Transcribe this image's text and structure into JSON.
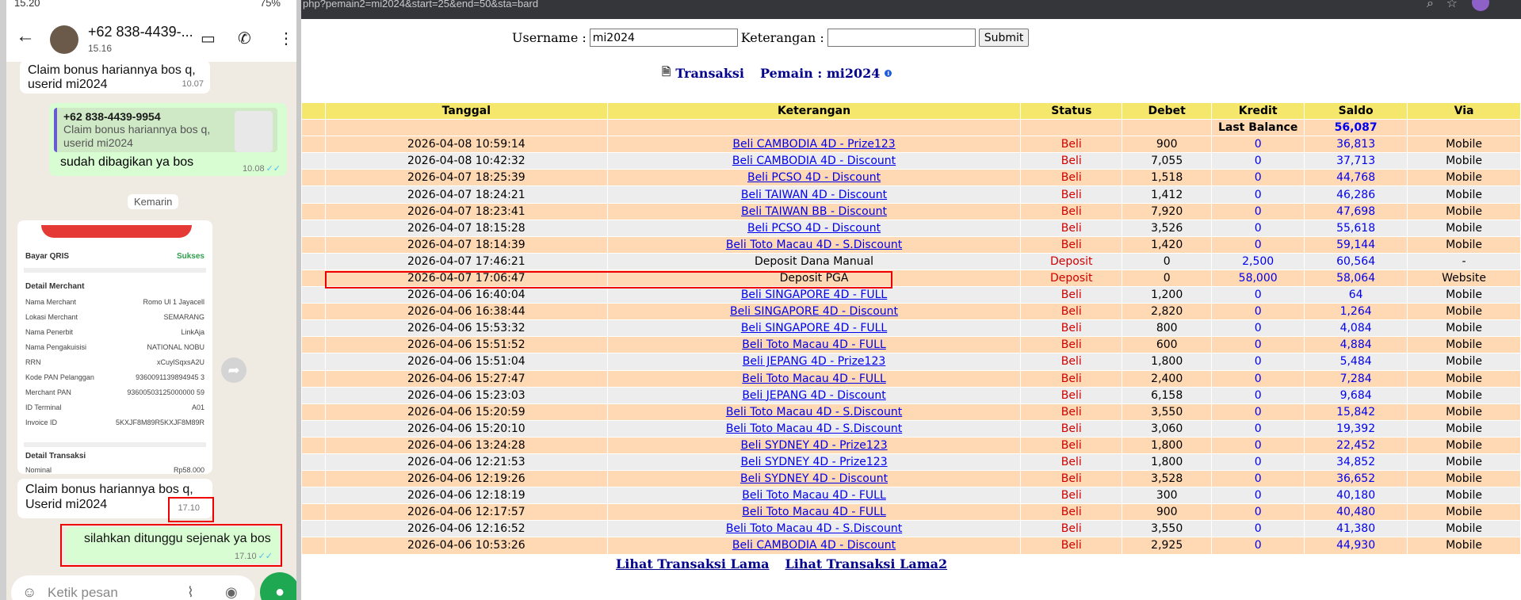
{
  "browser": {
    "url": "php?pemain2=mi2024&start=25&end=50&sta=bard",
    "search_icon": "search-icon",
    "star_icon": "star-icon"
  },
  "form": {
    "username_label": "Username :",
    "username_value": "mi2024",
    "keterangan_label": "Keterangan :",
    "keterangan_value": "",
    "submit_label": "Submit"
  },
  "heading": {
    "transaksi": "Transaksi",
    "pemain": "Pemain : mi2024"
  },
  "table": {
    "headers": [
      "Tanggal",
      "Keterangan",
      "Status",
      "Debet",
      "Kredit",
      "Saldo",
      "Via"
    ],
    "last_balance_label": "Last Balance",
    "last_balance_value": "56,087",
    "rows": [
      {
        "tanggal": "2026-04-08 10:59:14",
        "keterangan": "Beli CAMBODIA 4D - Prize123",
        "link": true,
        "status": "Beli",
        "debet": "900",
        "kredit": "0",
        "saldo": "36,813",
        "via": "Mobile"
      },
      {
        "tanggal": "2026-04-08 10:42:32",
        "keterangan": "Beli CAMBODIA 4D - Discount",
        "link": true,
        "status": "Beli",
        "debet": "7,055",
        "kredit": "0",
        "saldo": "37,713",
        "via": "Mobile"
      },
      {
        "tanggal": "2026-04-07 18:25:39",
        "keterangan": "Beli PCSO 4D - Discount",
        "link": true,
        "status": "Beli",
        "debet": "1,518",
        "kredit": "0",
        "saldo": "44,768",
        "via": "Mobile"
      },
      {
        "tanggal": "2026-04-07 18:24:21",
        "keterangan": "Beli TAIWAN 4D - Discount",
        "link": true,
        "status": "Beli",
        "debet": "1,412",
        "kredit": "0",
        "saldo": "46,286",
        "via": "Mobile"
      },
      {
        "tanggal": "2026-04-07 18:23:41",
        "keterangan": "Beli TAIWAN BB - Discount",
        "link": true,
        "status": "Beli",
        "debet": "7,920",
        "kredit": "0",
        "saldo": "47,698",
        "via": "Mobile"
      },
      {
        "tanggal": "2026-04-07 18:15:28",
        "keterangan": "Beli PCSO 4D - Discount",
        "link": true,
        "status": "Beli",
        "debet": "3,526",
        "kredit": "0",
        "saldo": "55,618",
        "via": "Mobile"
      },
      {
        "tanggal": "2026-04-07 18:14:39",
        "keterangan": "Beli Toto Macau 4D - S.Discount",
        "link": true,
        "status": "Beli",
        "debet": "1,420",
        "kredit": "0",
        "saldo": "59,144",
        "via": "Mobile"
      },
      {
        "tanggal": "2026-04-07 17:46:21",
        "keterangan": "Deposit Dana Manual",
        "link": false,
        "status": "Deposit",
        "debet": "0",
        "kredit": "2,500",
        "saldo": "60,564",
        "via": "-"
      },
      {
        "tanggal": "2026-04-07 17:06:47",
        "keterangan": "Deposit PGA",
        "link": false,
        "status": "Deposit",
        "debet": "0",
        "kredit": "58,000",
        "saldo": "58,064",
        "via": "Website"
      },
      {
        "tanggal": "2026-04-06 16:40:04",
        "keterangan": "Beli SINGAPORE 4D - FULL",
        "link": true,
        "status": "Beli",
        "debet": "1,200",
        "kredit": "0",
        "saldo": "64",
        "via": "Mobile"
      },
      {
        "tanggal": "2026-04-06 16:38:44",
        "keterangan": "Beli SINGAPORE 4D - Discount",
        "link": true,
        "status": "Beli",
        "debet": "2,820",
        "kredit": "0",
        "saldo": "1,264",
        "via": "Mobile"
      },
      {
        "tanggal": "2026-04-06 15:53:32",
        "keterangan": "Beli SINGAPORE 4D - FULL",
        "link": true,
        "status": "Beli",
        "debet": "800",
        "kredit": "0",
        "saldo": "4,084",
        "via": "Mobile"
      },
      {
        "tanggal": "2026-04-06 15:51:52",
        "keterangan": "Beli Toto Macau 4D - FULL",
        "link": true,
        "status": "Beli",
        "debet": "600",
        "kredit": "0",
        "saldo": "4,884",
        "via": "Mobile"
      },
      {
        "tanggal": "2026-04-06 15:51:04",
        "keterangan": "Beli JEPANG 4D - Prize123",
        "link": true,
        "status": "Beli",
        "debet": "1,800",
        "kredit": "0",
        "saldo": "5,484",
        "via": "Mobile"
      },
      {
        "tanggal": "2026-04-06 15:27:47",
        "keterangan": "Beli Toto Macau 4D - FULL",
        "link": true,
        "status": "Beli",
        "debet": "2,400",
        "kredit": "0",
        "saldo": "7,284",
        "via": "Mobile"
      },
      {
        "tanggal": "2026-04-06 15:23:03",
        "keterangan": "Beli JEPANG 4D - Discount",
        "link": true,
        "status": "Beli",
        "debet": "6,158",
        "kredit": "0",
        "saldo": "9,684",
        "via": "Mobile"
      },
      {
        "tanggal": "2026-04-06 15:20:59",
        "keterangan": "Beli Toto Macau 4D - S.Discount",
        "link": true,
        "status": "Beli",
        "debet": "3,550",
        "kredit": "0",
        "saldo": "15,842",
        "via": "Mobile"
      },
      {
        "tanggal": "2026-04-06 15:20:10",
        "keterangan": "Beli Toto Macau 4D - S.Discount",
        "link": true,
        "status": "Beli",
        "debet": "3,060",
        "kredit": "0",
        "saldo": "19,392",
        "via": "Mobile"
      },
      {
        "tanggal": "2026-04-06 13:24:28",
        "keterangan": "Beli SYDNEY 4D - Prize123",
        "link": true,
        "status": "Beli",
        "debet": "1,800",
        "kredit": "0",
        "saldo": "22,452",
        "via": "Mobile"
      },
      {
        "tanggal": "2026-04-06 12:21:53",
        "keterangan": "Beli SYDNEY 4D - Prize123",
        "link": true,
        "status": "Beli",
        "debet": "1,800",
        "kredit": "0",
        "saldo": "34,852",
        "via": "Mobile"
      },
      {
        "tanggal": "2026-04-06 12:19:26",
        "keterangan": "Beli SYDNEY 4D - Discount",
        "link": true,
        "status": "Beli",
        "debet": "3,528",
        "kredit": "0",
        "saldo": "36,652",
        "via": "Mobile"
      },
      {
        "tanggal": "2026-04-06 12:18:19",
        "keterangan": "Beli Toto Macau 4D - FULL",
        "link": true,
        "status": "Beli",
        "debet": "300",
        "kredit": "0",
        "saldo": "40,180",
        "via": "Mobile"
      },
      {
        "tanggal": "2026-04-06 12:17:57",
        "keterangan": "Beli Toto Macau 4D - FULL",
        "link": true,
        "status": "Beli",
        "debet": "900",
        "kredit": "0",
        "saldo": "40,480",
        "via": "Mobile"
      },
      {
        "tanggal": "2026-04-06 12:16:52",
        "keterangan": "Beli Toto Macau 4D - S.Discount",
        "link": true,
        "status": "Beli",
        "debet": "3,550",
        "kredit": "0",
        "saldo": "41,380",
        "via": "Mobile"
      },
      {
        "tanggal": "2026-04-06 10:53:26",
        "keterangan": "Beli CAMBODIA 4D - Discount",
        "link": true,
        "status": "Beli",
        "debet": "2,925",
        "kredit": "0",
        "saldo": "44,930",
        "via": "Mobile"
      }
    ]
  },
  "footer": {
    "link1": "Lihat Transaksi Lama",
    "link2": "Lihat Transaksi Lama2"
  },
  "phone": {
    "status_time": "15.20",
    "status_battery": "75%",
    "contact_name": "+62 838-4439-...",
    "contact_sub": "15.16",
    "msg1_text": "Claim bonus hariannya bos q, userid mi2024",
    "msg1_time": "10.07",
    "quote_name": "+62 838-4439-9954",
    "quote_text": "Claim bonus hariannya bos q, userid mi2024",
    "reply_text": "sudah dibagikan ya bos",
    "reply_time": "10.08",
    "date_chip": "Kemarin",
    "receipt": {
      "title": "Bayar QRIS",
      "status": "Sukses",
      "section1": "Detail Merchant",
      "rows": [
        {
          "k": "Nama Merchant",
          "v": "Romo Ul 1 Jayacell"
        },
        {
          "k": "Lokasi Merchant",
          "v": "SEMARANG"
        },
        {
          "k": "Nama Penerbit",
          "v": "LinkAja"
        },
        {
          "k": "Nama Pengakuisisi",
          "v": "NATIONAL NOBU"
        },
        {
          "k": "RRN",
          "v": "xCuylSqxsA2U"
        },
        {
          "k": "Kode PAN Pelanggan",
          "v": "9360091139894945 3"
        },
        {
          "k": "Merchant PAN",
          "v": "93600503125000000 59"
        },
        {
          "k": "ID Terminal",
          "v": "A01"
        },
        {
          "k": "Invoice ID",
          "v": "5KXJF8M89R5KXJF8M89R"
        }
      ],
      "section2": "Detail Transaksi",
      "nominal_label": "Nominal",
      "nominal_value": "Rp58.000"
    },
    "msg2_text": "Claim bonus hariannya bos q, Userid mi2024",
    "msg2_time": "17.10",
    "reply2_text": "silahkan ditunggu sejenak ya bos",
    "reply2_time": "17.10",
    "compose_placeholder": "Ketik pesan"
  }
}
